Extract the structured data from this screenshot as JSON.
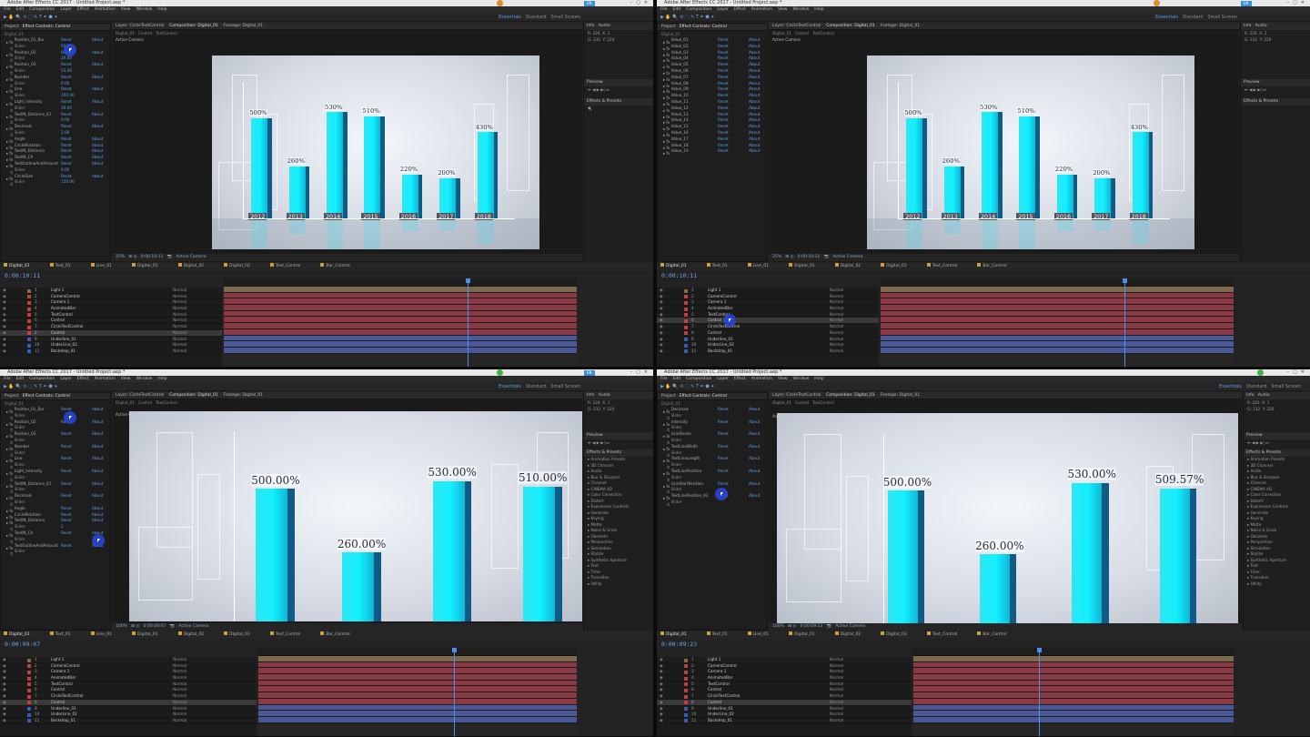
{
  "app": {
    "title": "Adobe After Effects CC 2017 - Untitled Project.aep *",
    "menu": [
      "File",
      "Edit",
      "Composition",
      "Layer",
      "Effect",
      "Animation",
      "View",
      "Window",
      "Help"
    ],
    "workspace": [
      "Essentials",
      "Standard",
      "Small Screen"
    ],
    "colors": {
      "accent": "#5d9de3",
      "bar": "#12f0ff",
      "bar_side": "#0e5b86",
      "timecode": "#6fa3e6"
    }
  },
  "quad_tl": {
    "panel_tabs": [
      "Project",
      "Effect Controls: Control"
    ],
    "comp_tabs": [
      "Layer: CircleTextControl",
      "Composition: Digital_01",
      "Footage: Digital_01"
    ],
    "comp_sub": [
      "Digital_01",
      "Control",
      "TextControl"
    ],
    "view_label": "Active Camera",
    "effects": [
      {
        "name": "Position_01_Bar",
        "value": "Reset",
        "about": "About"
      },
      {
        "name": "Slider",
        "value": "50.00",
        "about": ""
      },
      {
        "name": "Position_02",
        "value": "Reset",
        "about": "About"
      },
      {
        "name": "Slider",
        "value": "26.00",
        "about": ""
      },
      {
        "name": "Position_03",
        "value": "Reset",
        "about": "About"
      },
      {
        "name": "Slider",
        "value": "53.00",
        "about": ""
      },
      {
        "name": "Number",
        "value": "Reset",
        "about": "About"
      },
      {
        "name": "Slider",
        "value": "0.00",
        "about": ""
      },
      {
        "name": "Line",
        "value": "Reset",
        "about": "About"
      },
      {
        "name": "Slider",
        "value": "100.00",
        "about": ""
      },
      {
        "name": "Light_Intensity",
        "value": "Reset",
        "about": "About"
      },
      {
        "name": "Slider",
        "value": "30.00",
        "about": ""
      },
      {
        "name": "TextIN_Distance_01",
        "value": "Reset",
        "about": "About"
      },
      {
        "name": "Slider",
        "value": "0.00",
        "about": ""
      },
      {
        "name": "Decimals",
        "value": "Reset",
        "about": "About"
      },
      {
        "name": "Slider",
        "value": "2.00",
        "about": ""
      },
      {
        "name": "Angle",
        "value": "Reset",
        "about": "About"
      },
      {
        "name": "CircleRotation",
        "value": "Reset",
        "about": "About"
      },
      {
        "name": "TextIN_Distance",
        "value": "Reset",
        "about": "About"
      },
      {
        "name": "TextIN_Ch",
        "value": "Reset",
        "about": "About"
      },
      {
        "name": "TextOutlineAndAmount",
        "value": "Reset",
        "about": "About"
      },
      {
        "name": "Slider",
        "value": "0.00",
        "about": ""
      },
      {
        "name": "CircleSize",
        "value": "Reset",
        "about": "About"
      },
      {
        "name": "Slider",
        "value": "120.00",
        "about": ""
      }
    ],
    "zoom": "25%",
    "timecode": "0:00:10:11",
    "footer_view": "Active Camera",
    "layers": [
      {
        "num": "1",
        "name": "Light 1",
        "color": "#8a6a3a"
      },
      {
        "num": "2",
        "name": "CameraControl",
        "color": "#c04040"
      },
      {
        "num": "3",
        "name": "Camera 1",
        "color": "#c04040"
      },
      {
        "num": "4",
        "name": "AnimatedBar",
        "color": "#c04040"
      },
      {
        "num": "5",
        "name": "TextControl",
        "color": "#c04040"
      },
      {
        "num": "6",
        "name": "Control",
        "color": "#c04040"
      },
      {
        "num": "7",
        "name": "CircleTextControl",
        "color": "#c04040"
      },
      {
        "num": "8",
        "name": "Control",
        "color": "#c04040"
      },
      {
        "num": "9",
        "name": "Underline_01",
        "color": "#3a5cb0"
      },
      {
        "num": "10",
        "name": "UnderLine_02",
        "color": "#3a5cb0"
      },
      {
        "num": "11",
        "name": "Backdrop_01",
        "color": "#3a5cb0"
      }
    ],
    "modes": [
      "Normal",
      "None"
    ]
  },
  "quad_tr": {
    "effects": [
      {
        "name": "Value_01",
        "value": "Reset",
        "about": "About"
      },
      {
        "name": "Value_02",
        "value": "Reset",
        "about": "About"
      },
      {
        "name": "Value_03",
        "value": "Reset",
        "about": "About"
      },
      {
        "name": "Value_04",
        "value": "Reset",
        "about": "About"
      },
      {
        "name": "Value_05",
        "value": "Reset",
        "about": "About"
      },
      {
        "name": "Value_06",
        "value": "Reset",
        "about": "About"
      },
      {
        "name": "Value_07",
        "value": "Reset",
        "about": "About"
      },
      {
        "name": "Value_08",
        "value": "Reset",
        "about": "About"
      },
      {
        "name": "Value_09",
        "value": "Reset",
        "about": "About"
      },
      {
        "name": "Value_10",
        "value": "Reset",
        "about": "About"
      },
      {
        "name": "Value_11",
        "value": "Reset",
        "about": "About"
      },
      {
        "name": "Value_12",
        "value": "Reset",
        "about": "About"
      },
      {
        "name": "Value_13",
        "value": "Reset",
        "about": "About"
      },
      {
        "name": "Value_14",
        "value": "Reset",
        "about": "About"
      },
      {
        "name": "Value_15",
        "value": "Reset",
        "about": "About"
      },
      {
        "name": "Value_16",
        "value": "Reset",
        "about": "About"
      },
      {
        "name": "Value_17",
        "value": "Reset",
        "about": "About"
      },
      {
        "name": "Value_18",
        "value": "Reset",
        "about": "About"
      },
      {
        "name": "Value_19",
        "value": "Reset",
        "about": "About"
      }
    ],
    "timecode": "0:00:10:11",
    "layers": [
      {
        "num": "1",
        "name": "Light 1",
        "color": "#8a6a3a"
      },
      {
        "num": "2",
        "name": "CameraControl",
        "color": "#c04040"
      },
      {
        "num": "3",
        "name": "Camera 1",
        "color": "#c04040"
      },
      {
        "num": "4",
        "name": "AnimatedBar",
        "color": "#c04040"
      },
      {
        "num": "5",
        "name": "TextControl",
        "color": "#c04040"
      },
      {
        "num": "6",
        "name": "Control",
        "color": "#c04040"
      },
      {
        "num": "7",
        "name": "CircleTextControl",
        "color": "#c04040"
      },
      {
        "num": "8",
        "name": "Control",
        "color": "#c04040"
      },
      {
        "num": "9",
        "name": "Underline_01",
        "color": "#3a5cb0"
      },
      {
        "num": "10",
        "name": "UnderLine_02",
        "color": "#3a5cb0"
      },
      {
        "num": "11",
        "name": "Backdrop_01",
        "color": "#3a5cb0"
      }
    ]
  },
  "quad_bl": {
    "timecode": "0:00:09:07",
    "zoom": "100%",
    "effects": [
      {
        "name": "Position_01_Bar",
        "value": "Reset",
        "about": "About"
      },
      {
        "name": "Slider",
        "value": "",
        "about": ""
      },
      {
        "name": "Position_02",
        "value": "Reset",
        "about": "About"
      },
      {
        "name": "Slider",
        "value": "",
        "about": ""
      },
      {
        "name": "Position_03",
        "value": "Reset",
        "about": "About"
      },
      {
        "name": "Slider",
        "value": "",
        "about": ""
      },
      {
        "name": "Number",
        "value": "Reset",
        "about": "About"
      },
      {
        "name": "Slider",
        "value": "",
        "about": ""
      },
      {
        "name": "Line",
        "value": "Reset",
        "about": "About"
      },
      {
        "name": "Slider",
        "value": "",
        "about": ""
      },
      {
        "name": "Light_Intensity",
        "value": "Reset",
        "about": "About"
      },
      {
        "name": "Slider",
        "value": "",
        "about": ""
      },
      {
        "name": "TextIN_Distance_01",
        "value": "Reset",
        "about": "About"
      },
      {
        "name": "Slider",
        "value": "",
        "about": ""
      },
      {
        "name": "Decimals",
        "value": "Reset",
        "about": "About"
      },
      {
        "name": "Slider",
        "value": "",
        "about": ""
      },
      {
        "name": "Angle",
        "value": "Reset",
        "about": "About"
      },
      {
        "name": "CircleRotation",
        "value": "Reset",
        "about": "About"
      },
      {
        "name": "TextIN_Distance",
        "value": "Reset",
        "about": "About"
      },
      {
        "name": "Slider",
        "value": "2",
        "about": ""
      },
      {
        "name": "TextIN_Ch",
        "value": "Reset",
        "about": "About"
      },
      {
        "name": "Slider",
        "value": "",
        "about": ""
      },
      {
        "name": "TextOutlineAndAmount",
        "value": "Reset",
        "about": "About"
      },
      {
        "name": "Slider",
        "value": "",
        "about": ""
      }
    ],
    "effects_presets": [
      "Animation Presets",
      "3D Channel",
      "Audio",
      "Blur & Sharpen",
      "Channel",
      "CINEMA 4D",
      "Color Correction",
      "Distort",
      "Expression Controls",
      "Generate",
      "Keying",
      "Matte",
      "Noise & Grain",
      "Obsolete",
      "Perspective",
      "Simulation",
      "Stylize",
      "Synthetic Aperture",
      "Text",
      "Time",
      "Transition",
      "Utility"
    ],
    "layers": [
      {
        "num": "1",
        "name": "Light 1",
        "color": "#8a6a3a"
      },
      {
        "num": "2",
        "name": "CameraControl",
        "color": "#c04040"
      },
      {
        "num": "3",
        "name": "Camera 1",
        "color": "#c04040"
      },
      {
        "num": "4",
        "name": "AnimatedBar",
        "color": "#c04040"
      },
      {
        "num": "5",
        "name": "TextControl",
        "color": "#c04040"
      },
      {
        "num": "6",
        "name": "Control",
        "color": "#c04040"
      },
      {
        "num": "7",
        "name": "CircleTextControl",
        "color": "#c04040"
      },
      {
        "num": "8",
        "name": "Control",
        "color": "#c04040"
      },
      {
        "num": "9",
        "name": "Underline_01",
        "color": "#3a5cb0"
      },
      {
        "num": "10",
        "name": "UnderLine_02",
        "color": "#3a5cb0"
      },
      {
        "num": "11",
        "name": "Backdrop_01",
        "color": "#3a5cb0"
      }
    ]
  },
  "quad_br": {
    "timecode": "0:00:09:23",
    "zoom": "100%",
    "effects": [
      {
        "name": "Decimals",
        "value": "Reset",
        "about": "About"
      },
      {
        "name": "Slider",
        "value": "",
        "about": ""
      },
      {
        "name": "Intensity",
        "value": "Reset",
        "about": "About"
      },
      {
        "name": "Slider",
        "value": "",
        "about": ""
      },
      {
        "name": "LineStroke",
        "value": "Reset",
        "about": "About"
      },
      {
        "name": "Slider",
        "value": "",
        "about": ""
      },
      {
        "name": "TextLineWidth",
        "value": "Reset",
        "about": "About"
      },
      {
        "name": "Slider",
        "value": "",
        "about": ""
      },
      {
        "name": "TextLineLength",
        "value": "Reset",
        "about": "About"
      },
      {
        "name": "Slider",
        "value": "",
        "about": ""
      },
      {
        "name": "TextLinePosition",
        "value": "Reset",
        "about": "About"
      },
      {
        "name": "Slider",
        "value": "",
        "about": ""
      },
      {
        "name": "LineStartPosition",
        "value": "Reset",
        "about": "About"
      },
      {
        "name": "Slider",
        "value": "",
        "about": ""
      },
      {
        "name": "TextLinePosition_02",
        "value": "Reset",
        "about": "About"
      },
      {
        "name": "Slider",
        "value": "",
        "about": ""
      }
    ],
    "layers": [
      {
        "num": "1",
        "name": "Light 1",
        "color": "#8a6a3a"
      },
      {
        "num": "2",
        "name": "CameraControl",
        "color": "#c04040"
      },
      {
        "num": "3",
        "name": "Camera 1",
        "color": "#c04040"
      },
      {
        "num": "4",
        "name": "AnimatedBar",
        "color": "#c04040"
      },
      {
        "num": "5",
        "name": "TextControl",
        "color": "#c04040"
      },
      {
        "num": "6",
        "name": "Control",
        "color": "#c04040"
      },
      {
        "num": "7",
        "name": "CircleTextControl",
        "color": "#c04040"
      },
      {
        "num": "8",
        "name": "Control",
        "color": "#c04040"
      },
      {
        "num": "9",
        "name": "Underline_01",
        "color": "#3a5cb0"
      },
      {
        "num": "10",
        "name": "UnderLine_02",
        "color": "#3a5cb0"
      },
      {
        "num": "11",
        "name": "Backdrop_01",
        "color": "#3a5cb0"
      }
    ]
  },
  "chart_data": [
    {
      "type": "bar",
      "categories": [
        "2012",
        "2013",
        "2014",
        "2015",
        "2016",
        "2017",
        "2018"
      ],
      "values": [
        500,
        260,
        530,
        510,
        220,
        200,
        430
      ],
      "labels": [
        "500%",
        "260%",
        "530%",
        "510%",
        "220%",
        "200%",
        "430%"
      ],
      "ylim": [
        0,
        600
      ]
    },
    {
      "type": "bar",
      "categories": [
        "2012",
        "2013",
        "2014",
        "2015",
        "2016",
        "2017",
        "2018"
      ],
      "values": [
        500,
        260,
        530,
        510,
        220,
        200,
        430
      ],
      "labels": [
        "500%",
        "260%",
        "530%",
        "510%",
        "220%",
        "200%",
        "430%"
      ],
      "ylim": [
        0,
        600
      ]
    },
    {
      "type": "bar",
      "values": [
        500.0,
        260.0,
        530.0,
        510.0
      ],
      "labels": [
        "500.00%",
        "260.00%",
        "530.00%",
        "510.00%"
      ],
      "ylim": [
        0,
        600
      ]
    },
    {
      "type": "bar",
      "values": [
        500.0,
        260.0,
        530.0,
        509.57
      ],
      "labels": [
        "500.00%",
        "260.00%",
        "530.00%",
        "509.57%"
      ],
      "ylim": [
        0,
        600
      ]
    }
  ]
}
